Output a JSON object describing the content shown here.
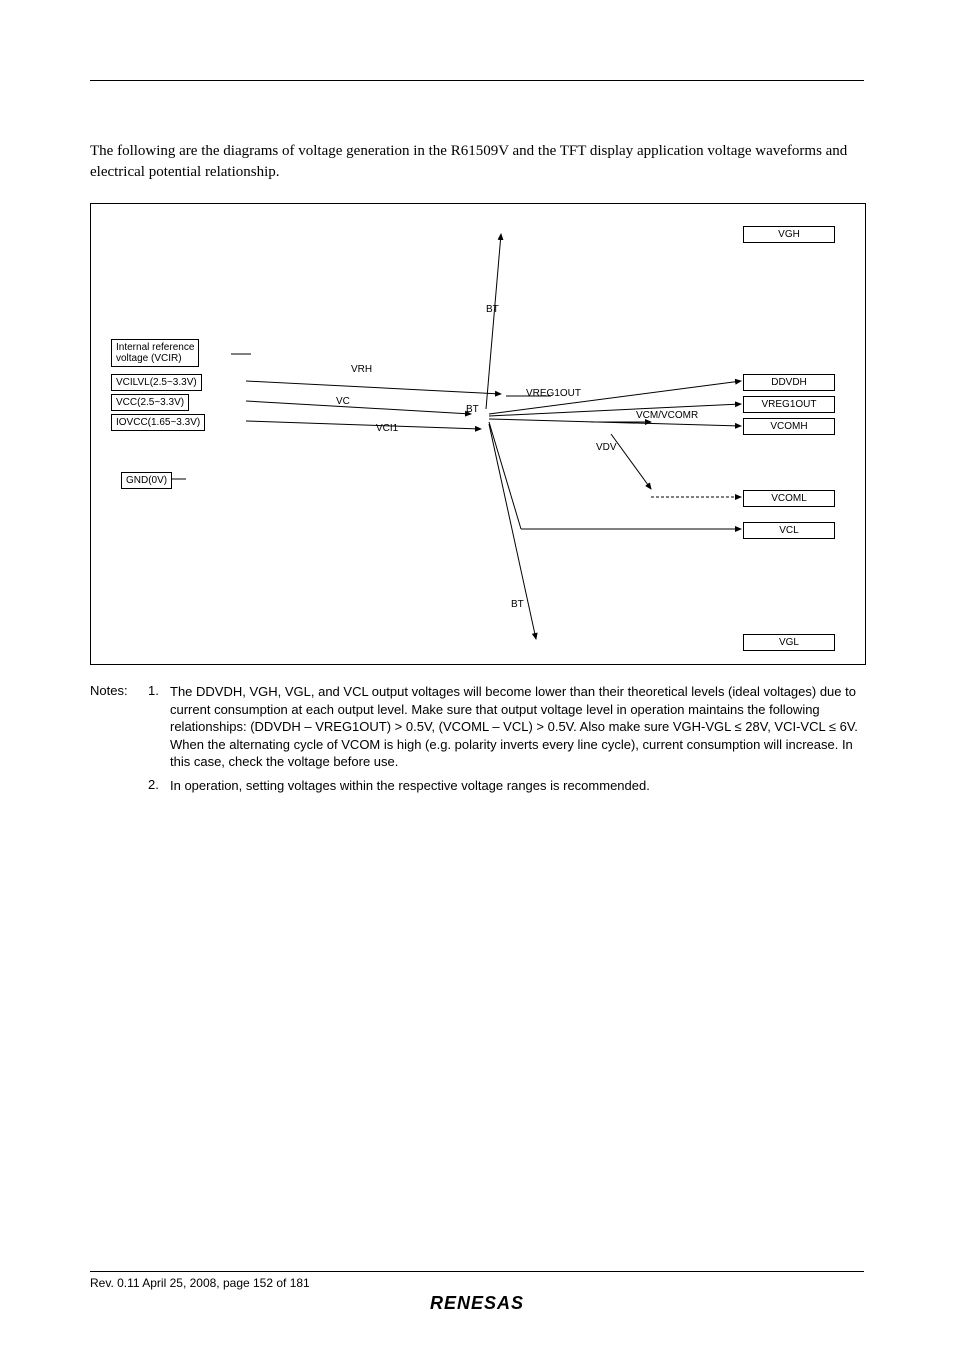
{
  "intro": "The following are the diagrams of voltage generation in the R61509V and the TFT display application voltage waveforms and electrical potential relationship.",
  "diagram": {
    "left": {
      "vcir": "Internal reference\nvoltage (VCIR)",
      "vcilvl": "VCILVL(2.5~3.3V)",
      "vcc": "VCC(2.5~3.3V)",
      "iovcc": "IOVCC(1.65~3.3V)",
      "gnd": "GND(0V)"
    },
    "mid": {
      "vrh": "VRH",
      "vc": "VC",
      "vci1": "VCI1",
      "bt1": "BT",
      "bt2": "BT",
      "bt3": "BT",
      "vreg1out": "VREG1OUT",
      "vcmvcomr": "VCM/VCOMR",
      "vdv": "VDV"
    },
    "right": {
      "vgh": "VGH",
      "ddvdh": "DDVDH",
      "vreg1out": "VREG1OUT",
      "vcomh": "VCOMH",
      "vcoml": "VCOML",
      "vcl": "VCL",
      "vgl": "VGL"
    }
  },
  "notes": {
    "prefix": "Notes:",
    "items": [
      {
        "num": "1.",
        "text": "The DDVDH, VGH, VGL, and VCL output voltages will become lower than their theoretical levels (ideal voltages) due to current consumption at each output level.  Make sure that output voltage level in operation maintains the following relationships: (DDVDH – VREG1OUT) > 0.5V, (VCOML – VCL) > 0.5V.  Also make sure VGH-VGL ≤ 28V, VCI-VCL ≤ 6V.  When the alternating cycle of VCOM is high (e.g. polarity inverts every line cycle), current consumption will increase.  In this case, check the voltage before use."
      },
      {
        "num": "2.",
        "text": "In operation, setting voltages within the respective voltage ranges is recommended."
      }
    ]
  },
  "footer": "Rev. 0.11 April 25, 2008, page 152 of 181",
  "logo": "RENESAS"
}
